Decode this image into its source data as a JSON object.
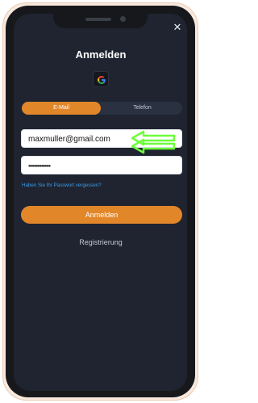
{
  "header": {
    "title": "Anmelden",
    "close_icon": "close-icon"
  },
  "social": {
    "google_icon": "google-icon"
  },
  "tabs": [
    {
      "label": "E-Mail",
      "active": true
    },
    {
      "label": "Telefon",
      "active": false
    }
  ],
  "form": {
    "email_value": "maxmuller@gmail.com",
    "password_value": "•••••••••••••••",
    "forgot_label": "Haben Sie Ihr Passwort vergessen?",
    "submit_label": "Anmelden",
    "register_label": "Registrierung"
  },
  "colors": {
    "accent": "#e2862a",
    "screen_bg": "#1f2430",
    "link": "#3d9be9",
    "annotation_arrow": "#6bff3a"
  }
}
